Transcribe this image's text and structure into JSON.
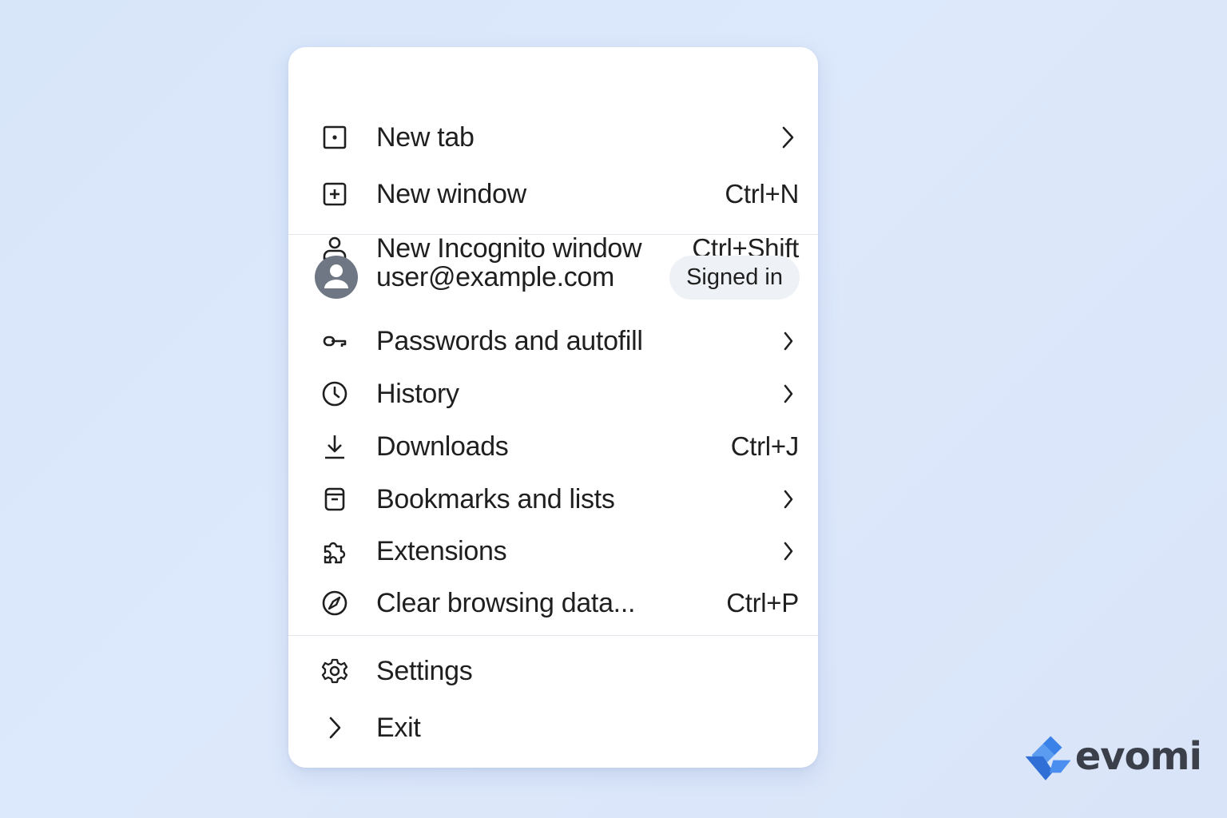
{
  "menu": {
    "items_top": [
      {
        "label": "New tab",
        "icon": "tab-icon",
        "trailing": "chevron"
      },
      {
        "label": "New window",
        "icon": "new-window-icon",
        "shortcut": "Ctrl+N"
      },
      {
        "label": "New Incognito window",
        "icon": "incognito-icon",
        "shortcut": "Ctrl+Shift"
      }
    ],
    "account": {
      "email": "user@example.com",
      "status": "Signed in",
      "icon": "avatar-icon"
    },
    "items_mid": [
      {
        "label": "Passwords and autofill",
        "icon": "key-icon",
        "trailing": "chevron"
      },
      {
        "label": "History",
        "icon": "clock-icon",
        "trailing": "chevron"
      },
      {
        "label": "Downloads",
        "icon": "download-icon",
        "shortcut": "Ctrl+J"
      },
      {
        "label": "Bookmarks and lists",
        "icon": "bookmark-icon",
        "trailing": "chevron"
      },
      {
        "label": "Extensions",
        "icon": "puzzle-icon",
        "trailing": "chevron"
      },
      {
        "label": "Clear browsing data...",
        "icon": "compass-icon",
        "shortcut": "Ctrl+P"
      }
    ],
    "items_bottom": [
      {
        "label": "Settings",
        "icon": "gear-icon"
      },
      {
        "label": "Exit",
        "icon": "chevron-right-icon"
      }
    ]
  },
  "brand": {
    "name": "evomi",
    "accent": "#3b82e8"
  },
  "colors": {
    "background": "#dbe7fa",
    "menu_bg": "#ffffff",
    "text": "#1f1f1f",
    "badge_bg": "#eef1f5",
    "avatar": "#6f7784"
  }
}
